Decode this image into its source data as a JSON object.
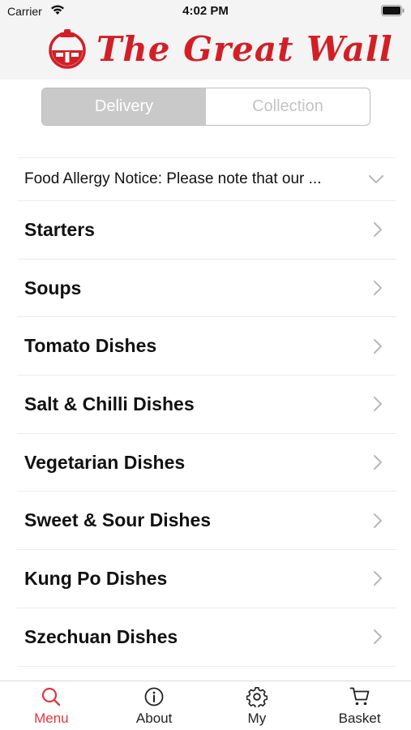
{
  "status_bar": {
    "carrier": "Carrier",
    "time": "4:02 PM"
  },
  "header": {
    "logo_text": "The Great Wall",
    "brand_color": "#d21f26"
  },
  "segments": [
    {
      "label": "Delivery",
      "selected": true
    },
    {
      "label": "Collection",
      "selected": false
    }
  ],
  "notice": {
    "text": "Food Allergy Notice: Please note that our ..."
  },
  "categories": [
    {
      "label": "Starters"
    },
    {
      "label": "Soups"
    },
    {
      "label": "Tomato Dishes"
    },
    {
      "label": "Salt & Chilli Dishes"
    },
    {
      "label": "Vegetarian Dishes"
    },
    {
      "label": "Sweet & Sour Dishes"
    },
    {
      "label": "Kung Po Dishes"
    },
    {
      "label": "Szechuan Dishes"
    }
  ],
  "tabs": [
    {
      "label": "Menu",
      "icon": "search-icon",
      "active": true
    },
    {
      "label": "About",
      "icon": "info-icon",
      "active": false
    },
    {
      "label": "My",
      "icon": "gear-icon",
      "active": false
    },
    {
      "label": "Basket",
      "icon": "cart-icon",
      "active": false
    }
  ],
  "colors": {
    "active_tab": "#e2373c",
    "segment_selected_bg": "#c9c9c9"
  }
}
